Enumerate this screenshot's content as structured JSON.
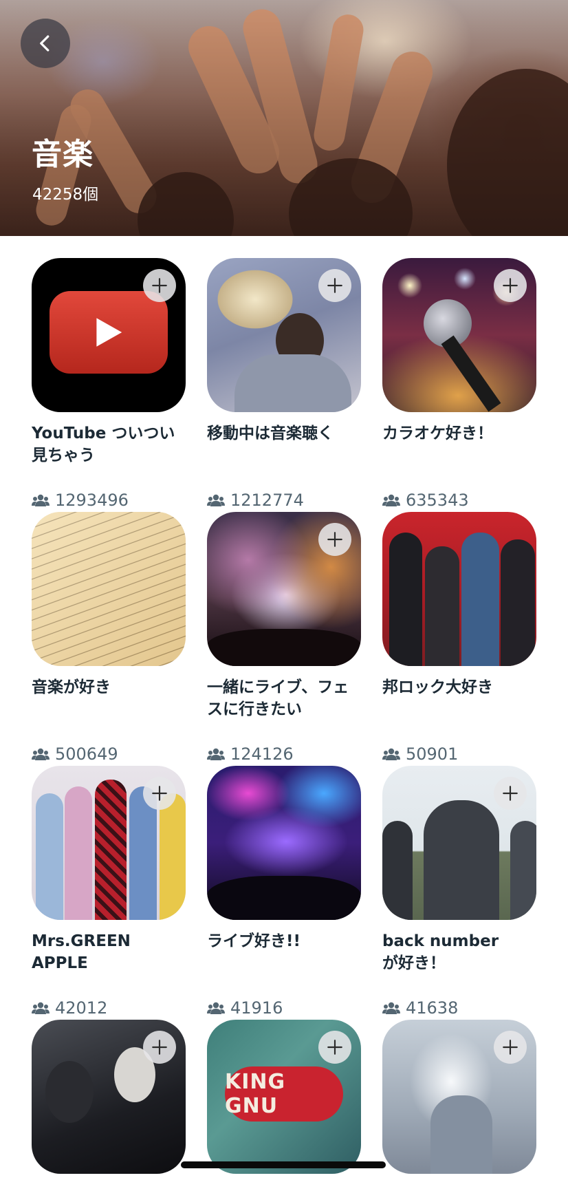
{
  "header": {
    "title": "音楽",
    "count": "42258個"
  },
  "colors": {
    "plus_button_bg": "#e6e6e8",
    "title_text": "#1c2a35",
    "member_text": "#546672"
  },
  "icons": {
    "back": "chevron-left-icon",
    "add": "plus-icon",
    "members": "people-icon"
  },
  "communities": [
    {
      "title": "YouTube ついつい\n見ちゃう",
      "members": "1293496",
      "image": "youtube-logo",
      "has_add_button": true
    },
    {
      "title": "移動中は音楽聴く",
      "members": "1212774",
      "image": "person-with-earphones",
      "has_add_button": true
    },
    {
      "title": "カラオケ好き！",
      "members": "635343",
      "image": "microphone-on-stage",
      "has_add_button": true
    },
    {
      "title": "音楽が好き",
      "members": "500649",
      "image": "sheet-music",
      "has_add_button": false
    },
    {
      "title": "一緒にライブ、フェ\nスに行きたい",
      "members": "124126",
      "image": "concert-crowd-smoke",
      "has_add_button": true
    },
    {
      "title": "邦ロック大好き",
      "members": "50901",
      "image": "rock-band-red-background",
      "has_add_button": false
    },
    {
      "title": "Mrs.GREEN\nAPPLE",
      "members": "42012",
      "image": "band-colorful-outfits",
      "has_add_button": true
    },
    {
      "title": "ライブ好き!!",
      "members": "41916",
      "image": "concert-stage-lights",
      "has_add_button": false
    },
    {
      "title": "back number\nが好き！",
      "members": "41638",
      "image": "band-on-sofa",
      "has_add_button": true
    },
    {
      "title": "",
      "members": "",
      "image": "band-dark-photo",
      "has_add_button": true
    },
    {
      "title": "",
      "members": "",
      "image": "king-gnu-logo",
      "logo_text": "KING GNU",
      "has_add_button": true
    },
    {
      "title": "",
      "members": "",
      "image": "flowers-dress",
      "has_add_button": true
    }
  ]
}
